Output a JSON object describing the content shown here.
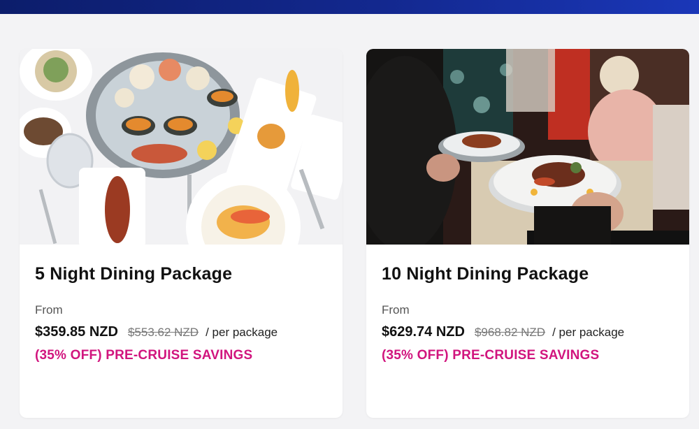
{
  "colors": {
    "banner": "#13288f",
    "savings": "#d1157e",
    "card_background": "#ffffff",
    "page_background": "#f3f3f5"
  },
  "packages": [
    {
      "title": "5 Night Dining Package",
      "from_label": "From",
      "price": "$359.85 NZD",
      "original_price": "$553.62 NZD",
      "price_unit": "/ per package",
      "savings": "(35% OFF) PRE-CRUISE SAVINGS",
      "image": "seafood-platter-photo"
    },
    {
      "title": "10 Night Dining Package",
      "from_label": "From",
      "price": "$629.74 NZD",
      "original_price": "$968.82 NZD",
      "price_unit": "/ per package",
      "savings": "(35% OFF) PRE-CRUISE SAVINGS",
      "image": "waiter-serving-dishes-photo"
    }
  ]
}
